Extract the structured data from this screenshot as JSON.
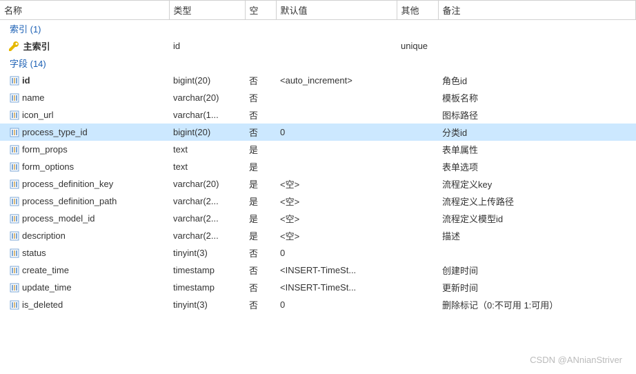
{
  "headers": {
    "name": "名称",
    "type": "类型",
    "null": "空",
    "default": "默认值",
    "other": "其他",
    "remark": "备注"
  },
  "groups": {
    "index": "索引 (1)",
    "fields": "字段 (14)"
  },
  "primary_index": {
    "name": "主索引",
    "type": "id",
    "other": "unique"
  },
  "fields": [
    {
      "name": "id",
      "type": "bigint(20)",
      "null": "否",
      "default": "<auto_increment>",
      "remark": "角色id",
      "bold": true
    },
    {
      "name": "name",
      "type": "varchar(20)",
      "null": "否",
      "default": "",
      "remark": "模板名称"
    },
    {
      "name": "icon_url",
      "type": "varchar(1...",
      "null": "否",
      "default": "",
      "remark": "图标路径"
    },
    {
      "name": "process_type_id",
      "type": "bigint(20)",
      "null": "否",
      "default": "0",
      "remark": "分类id",
      "selected": true
    },
    {
      "name": "form_props",
      "type": "text",
      "null": "是",
      "default": "",
      "remark": "表单属性"
    },
    {
      "name": "form_options",
      "type": "text",
      "null": "是",
      "default": "",
      "remark": "表单选项"
    },
    {
      "name": "process_definition_key",
      "type": "varchar(20)",
      "null": "是",
      "default": "<空>",
      "remark": "流程定义key"
    },
    {
      "name": "process_definition_path",
      "type": "varchar(2...",
      "null": "是",
      "default": "<空>",
      "remark": "流程定义上传路径"
    },
    {
      "name": "process_model_id",
      "type": "varchar(2...",
      "null": "是",
      "default": "<空>",
      "remark": "流程定义模型id"
    },
    {
      "name": "description",
      "type": "varchar(2...",
      "null": "是",
      "default": "<空>",
      "remark": "描述"
    },
    {
      "name": "status",
      "type": "tinyint(3)",
      "null": "否",
      "default": "0",
      "remark": ""
    },
    {
      "name": "create_time",
      "type": "timestamp",
      "null": "否",
      "default": "<INSERT-TimeSt...",
      "remark": "创建时间"
    },
    {
      "name": "update_time",
      "type": "timestamp",
      "null": "否",
      "default": "<INSERT-TimeSt...",
      "remark": "更新时间"
    },
    {
      "name": "is_deleted",
      "type": "tinyint(3)",
      "null": "否",
      "default": "0",
      "remark": "删除标记（0:不可用 1:可用）"
    }
  ],
  "watermark": "CSDN @ANnianStriver"
}
